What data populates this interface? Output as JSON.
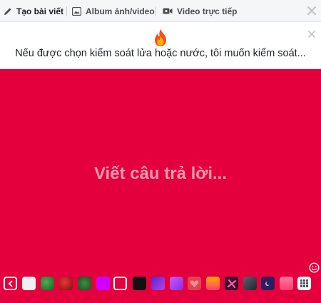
{
  "tabs": [
    {
      "label": "Tạo bài viết",
      "icon": "pencil-icon"
    },
    {
      "label": "Album ảnh/video",
      "icon": "photo-album-icon"
    },
    {
      "label": "Video trực tiếp",
      "icon": "live-video-icon"
    }
  ],
  "prompt": {
    "emoji": "fire-emoji",
    "text": "Nếu được chọn kiểm soát lửa hoặc nước, tôi muốn kiểm soát..."
  },
  "composer": {
    "placeholder": "Viết câu trả lời...",
    "background_color": "#e4003c"
  },
  "backgrounds": [
    {
      "name": "white",
      "color": "#f2f2f2"
    },
    {
      "name": "green-texture",
      "color": "#2e7d32"
    },
    {
      "name": "red-texture",
      "color": "#c62828"
    },
    {
      "name": "green-leaf",
      "color": "#2e6b2e"
    },
    {
      "name": "magenta",
      "color": "#d400ff"
    },
    {
      "name": "red-selected",
      "color": "#e4003c"
    },
    {
      "name": "black",
      "color": "#111111"
    },
    {
      "name": "purple-gradient",
      "color": "#7b2ff7"
    },
    {
      "name": "violet-gradient",
      "color": "#b34bff"
    },
    {
      "name": "hearts",
      "color": "#e0454f"
    },
    {
      "name": "orange-gradient",
      "color": "#ff8a00"
    },
    {
      "name": "pink-pattern",
      "color": "#b0145c"
    },
    {
      "name": "dark-gradient",
      "color": "#333a45"
    },
    {
      "name": "night-sky",
      "color": "#2a1f5c"
    },
    {
      "name": "pink-gradient",
      "color": "#ff5f8f"
    }
  ]
}
